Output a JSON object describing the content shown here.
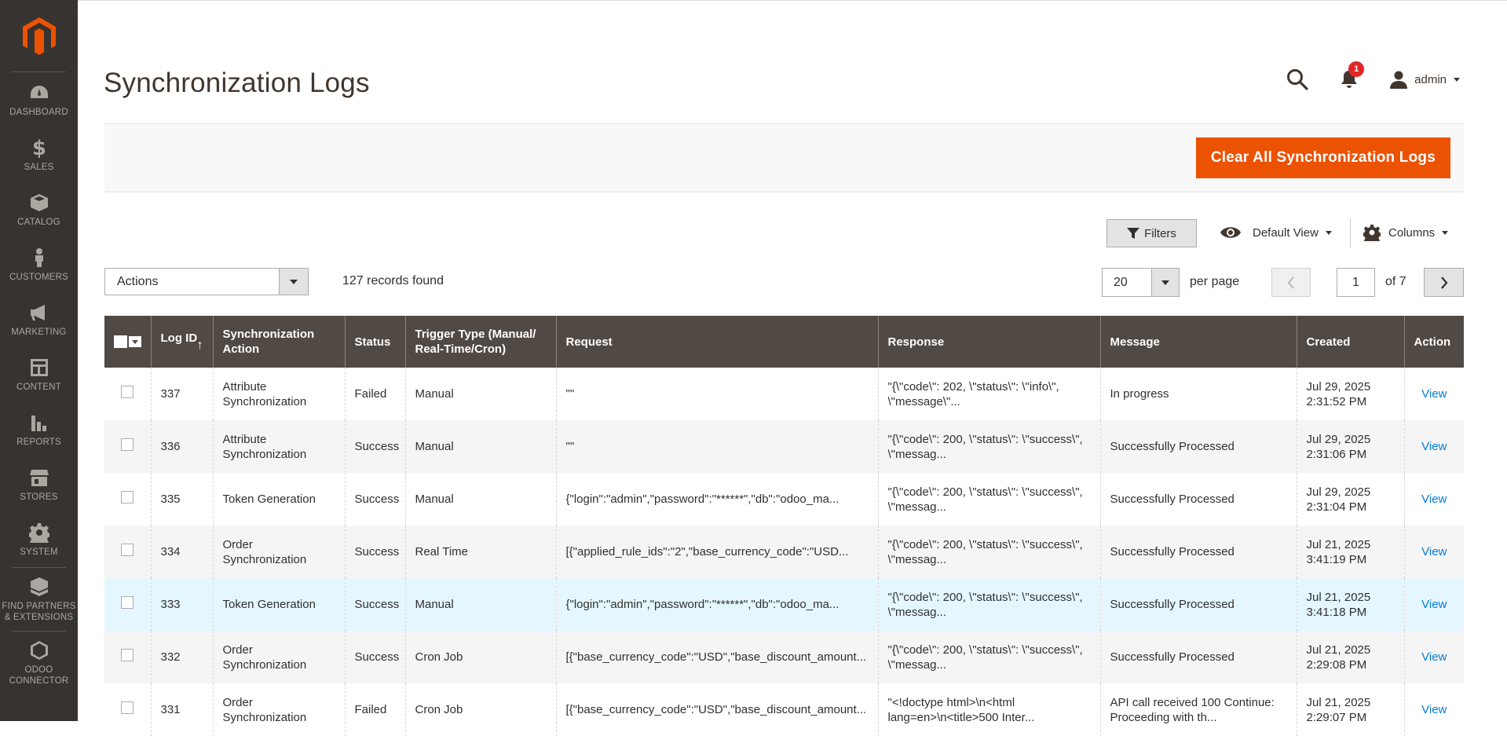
{
  "sidebar": {
    "items": [
      {
        "label": "DASHBOARD",
        "icon": "dashboard-icon"
      },
      {
        "label": "SALES",
        "icon": "dollar-icon"
      },
      {
        "label": "CATALOG",
        "icon": "box-icon"
      },
      {
        "label": "CUSTOMERS",
        "icon": "person-icon"
      },
      {
        "label": "MARKETING",
        "icon": "megaphone-icon"
      },
      {
        "label": "CONTENT",
        "icon": "layout-icon"
      },
      {
        "label": "REPORTS",
        "icon": "bar-chart-icon"
      },
      {
        "label": "STORES",
        "icon": "store-icon"
      },
      {
        "label": "SYSTEM",
        "icon": "gear-icon"
      }
    ],
    "extensions": {
      "line1": "FIND PARTNERS",
      "line2": "& EXTENSIONS"
    },
    "connector": {
      "line1": "ODOO",
      "line2": "CONNECTOR"
    }
  },
  "header": {
    "title": "Synchronization Logs",
    "notifications_count": "1",
    "user": "admin"
  },
  "action_band": {
    "clear_button": "Clear All Synchronization Logs"
  },
  "toolbar": {
    "filters": "Filters",
    "view": "Default View",
    "columns": "Columns",
    "actions": "Actions",
    "records": "127 records found",
    "per_page_value": "20",
    "per_page_label": "per page",
    "page_value": "1",
    "page_of": "of 7"
  },
  "table": {
    "headers": {
      "log_id": "Log ID",
      "sort": "↑",
      "sync_action": "Synchronization Action",
      "status": "Status",
      "trigger": "Trigger Type (Manual/ Real-Time/Cron)",
      "request": "Request",
      "response": "Response",
      "message": "Message",
      "created": "Created",
      "action": "Action"
    },
    "rows": [
      {
        "id": "337",
        "sync": "Attribute Synchronization",
        "status": "Failed",
        "trigger": "Manual",
        "request": "\"\"",
        "response1": "\"{\\\"code\\\": 202, \\\"status\\\": \\\"info\\\",",
        "response2": "\\\"message\\\"...",
        "message": "In progress",
        "date": "Jul 29, 2025",
        "time": "2:31:52 PM",
        "action": "View"
      },
      {
        "id": "336",
        "sync": "Attribute Synchronization",
        "status": "Success",
        "trigger": "Manual",
        "request": "\"\"",
        "response1": "\"{\\\"code\\\": 200, \\\"status\\\": \\\"success\\\",",
        "response2": "\\\"messag...",
        "message": "Successfully Processed",
        "date": "Jul 29, 2025",
        "time": "2:31:06 PM",
        "action": "View"
      },
      {
        "id": "335",
        "sync": "Token Generation",
        "status": "Success",
        "trigger": "Manual",
        "request": "{\"login\":\"admin\",\"password\":\"******\",\"db\":\"odoo_ma...",
        "response1": "\"{\\\"code\\\": 200, \\\"status\\\": \\\"success\\\",",
        "response2": "\\\"messag...",
        "message": "Successfully Processed",
        "date": "Jul 29, 2025",
        "time": "2:31:04 PM",
        "action": "View"
      },
      {
        "id": "334",
        "sync": "Order Synchronization",
        "status": "Success",
        "trigger": "Real Time",
        "request": "[{\"applied_rule_ids\":\"2\",\"base_currency_code\":\"USD...",
        "response1": "\"{\\\"code\\\": 200, \\\"status\\\": \\\"success\\\",",
        "response2": "\\\"messag...",
        "message": "Successfully Processed",
        "date": "Jul 21, 2025",
        "time": "3:41:19 PM",
        "action": "View"
      },
      {
        "id": "333",
        "sync": "Token Generation",
        "status": "Success",
        "trigger": "Manual",
        "request": "{\"login\":\"admin\",\"password\":\"******\",\"db\":\"odoo_ma...",
        "response1": "\"{\\\"code\\\": 200, \\\"status\\\": \\\"success\\\",",
        "response2": "\\\"messag...",
        "message": "Successfully Processed",
        "date": "Jul 21, 2025",
        "time": "3:41:18 PM",
        "action": "View"
      },
      {
        "id": "332",
        "sync": "Order Synchronization",
        "status": "Success",
        "trigger": "Cron Job",
        "request": "[{\"base_currency_code\":\"USD\",\"base_discount_amount...",
        "response1": "\"{\\\"code\\\": 200, \\\"status\\\": \\\"success\\\",",
        "response2": "\\\"messag...",
        "message": "Successfully Processed",
        "date": "Jul 21, 2025",
        "time": "2:29:08 PM",
        "action": "View"
      },
      {
        "id": "331",
        "sync": "Order Synchronization",
        "status": "Failed",
        "trigger": "Cron Job",
        "request": "[{\"base_currency_code\":\"USD\",\"base_discount_amount...",
        "response1": "\"<!doctype html>\\n<html",
        "response2": "lang=en>\\n<title>500 Inter...",
        "message": "API call received 100 Continue: Proceeding with th...",
        "date": "Jul 21, 2025",
        "time": "2:29:07 PM",
        "action": "View"
      }
    ]
  },
  "colors": {
    "accent": "#eb5202",
    "sidebar": "#373330",
    "table_header": "#514943",
    "link": "#007bdb",
    "highlight_row": "#e5f7fe"
  }
}
